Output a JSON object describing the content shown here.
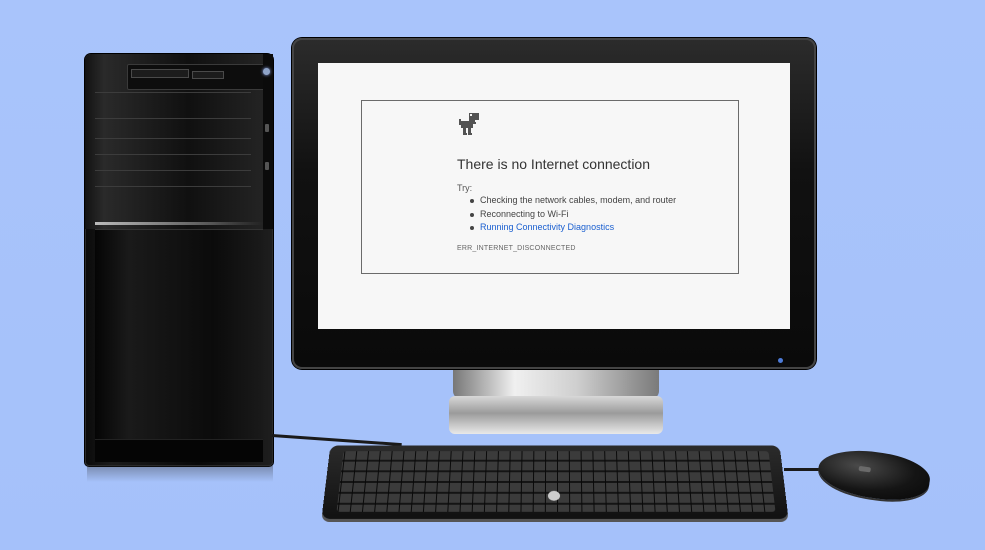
{
  "error_page": {
    "title": "There is no Internet connection",
    "try_label": "Try:",
    "suggestions": [
      "Checking the network cables, modem, and router",
      "Reconnecting to Wi-Fi"
    ],
    "diagnostics_link": "Running Connectivity Diagnostics",
    "error_code": "ERR_INTERNET_DISCONNECTED"
  },
  "colors": {
    "background": "#a9c4fb",
    "link": "#1a5fd0",
    "screen": "#f7f7f7"
  },
  "icons": {
    "error_icon": "dino-icon"
  }
}
